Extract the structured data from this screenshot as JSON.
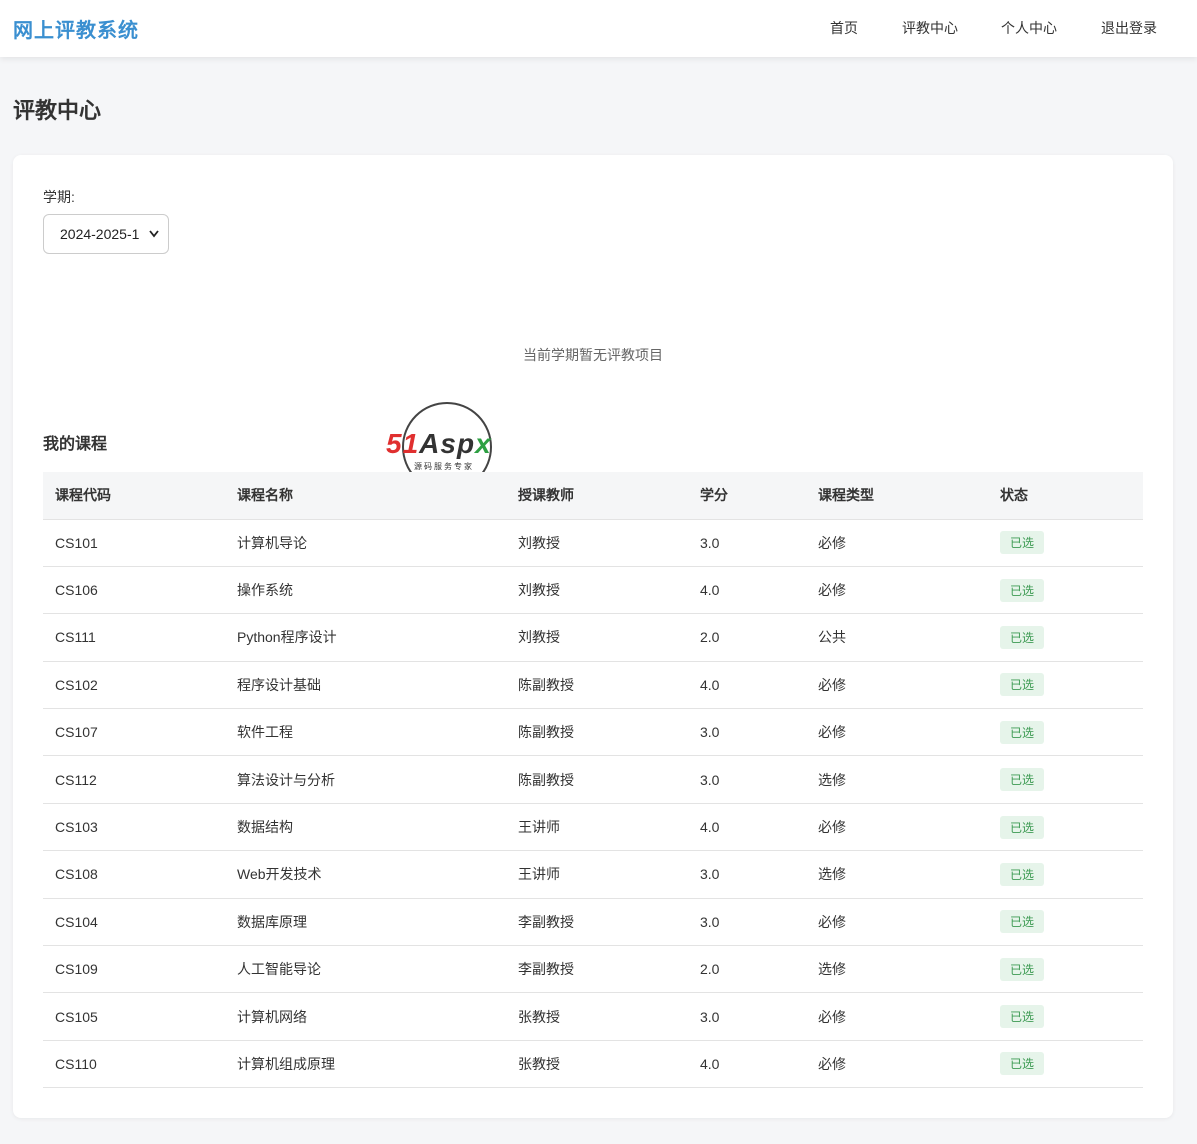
{
  "app": {
    "brand": "网上评教系统"
  },
  "nav": {
    "items": [
      {
        "label": "首页"
      },
      {
        "label": "评教中心"
      },
      {
        "label": "个人中心"
      },
      {
        "label": "退出登录"
      }
    ]
  },
  "page": {
    "title": "评教中心"
  },
  "filter": {
    "term_label": "学期:",
    "term_value": "2024-2025-1"
  },
  "evaluation": {
    "empty_message": "当前学期暂无评教项目"
  },
  "watermark": {
    "text_red": "51",
    "text_dark": "Asp",
    "text_green": "x",
    "subtitle": "源码服务专家"
  },
  "courses": {
    "section_title": "我的课程",
    "columns": [
      "课程代码",
      "课程名称",
      "授课教师",
      "学分",
      "课程类型",
      "状态"
    ],
    "rows": [
      {
        "code": "CS101",
        "name": "计算机导论",
        "teacher": "刘教授",
        "credit": "3.0",
        "type": "必修",
        "status": "已选"
      },
      {
        "code": "CS106",
        "name": "操作系统",
        "teacher": "刘教授",
        "credit": "4.0",
        "type": "必修",
        "status": "已选"
      },
      {
        "code": "CS111",
        "name": "Python程序设计",
        "teacher": "刘教授",
        "credit": "2.0",
        "type": "公共",
        "status": "已选"
      },
      {
        "code": "CS102",
        "name": "程序设计基础",
        "teacher": "陈副教授",
        "credit": "4.0",
        "type": "必修",
        "status": "已选"
      },
      {
        "code": "CS107",
        "name": "软件工程",
        "teacher": "陈副教授",
        "credit": "3.0",
        "type": "必修",
        "status": "已选"
      },
      {
        "code": "CS112",
        "name": "算法设计与分析",
        "teacher": "陈副教授",
        "credit": "3.0",
        "type": "选修",
        "status": "已选"
      },
      {
        "code": "CS103",
        "name": "数据结构",
        "teacher": "王讲师",
        "credit": "4.0",
        "type": "必修",
        "status": "已选"
      },
      {
        "code": "CS108",
        "name": "Web开发技术",
        "teacher": "王讲师",
        "credit": "3.0",
        "type": "选修",
        "status": "已选"
      },
      {
        "code": "CS104",
        "name": "数据库原理",
        "teacher": "李副教授",
        "credit": "3.0",
        "type": "必修",
        "status": "已选"
      },
      {
        "code": "CS109",
        "name": "人工智能导论",
        "teacher": "李副教授",
        "credit": "2.0",
        "type": "选修",
        "status": "已选"
      },
      {
        "code": "CS105",
        "name": "计算机网络",
        "teacher": "张教授",
        "credit": "3.0",
        "type": "必修",
        "status": "已选"
      },
      {
        "code": "CS110",
        "name": "计算机组成原理",
        "teacher": "张教授",
        "credit": "4.0",
        "type": "必修",
        "status": "已选"
      }
    ]
  },
  "colors": {
    "brand": "#3a8fd0",
    "badge_bg": "#e6f4ea",
    "badge_text": "#3c9a52"
  }
}
